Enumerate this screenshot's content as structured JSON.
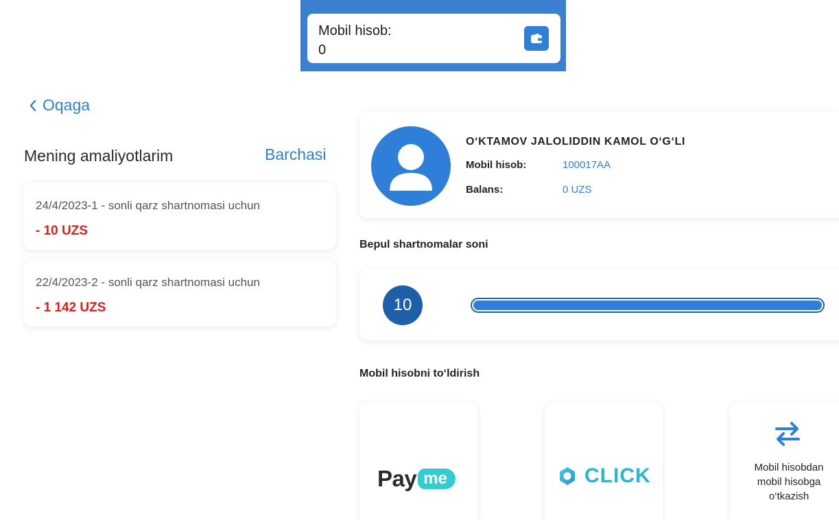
{
  "top_card": {
    "label": "Mobil hisob:",
    "value": "0"
  },
  "nav": {
    "back_label": "Oqaga"
  },
  "operations": {
    "title": "Mening amaliyotlarim",
    "all_label": "Barchasi",
    "items": [
      {
        "description": "24/4/2023-1 - sonli qarz shartnomasi uchun",
        "amount": "- 10 UZS"
      },
      {
        "description": "22/4/2023-2 - sonli qarz shartnomasi uchun",
        "amount": "- 1 142 UZS"
      }
    ]
  },
  "profile": {
    "name": "O‘KTAMOV JALOLIDDIN KAMOL O‘G‘LI",
    "account_label": "Mobil hisob:",
    "account_value": "100017AA",
    "balance_label": "Balans:",
    "balance_value": "0 UZS"
  },
  "free_contracts": {
    "title": "Bepul shartnomalar soni",
    "count": "10",
    "progress_fraction": 1.0
  },
  "topup": {
    "title": "Mobil hisobni to‘ldirish",
    "payme": {
      "text": "Pay",
      "pill": "me"
    },
    "click": {
      "text": "CLICK"
    },
    "transfer": {
      "label": "Mobil hisobdan\nmobil hisobga\no‘tkazish"
    }
  },
  "colors": {
    "accent": "#2f7ed8",
    "danger": "#d8201c",
    "banner": "#3a7fd0",
    "payme": "#33ccd1",
    "click": "#2bb4d6"
  },
  "icons": [
    "wallet-icon",
    "chevron-left-icon",
    "user-icon",
    "transfer-arrows-icon",
    "click-ring-icon"
  ]
}
